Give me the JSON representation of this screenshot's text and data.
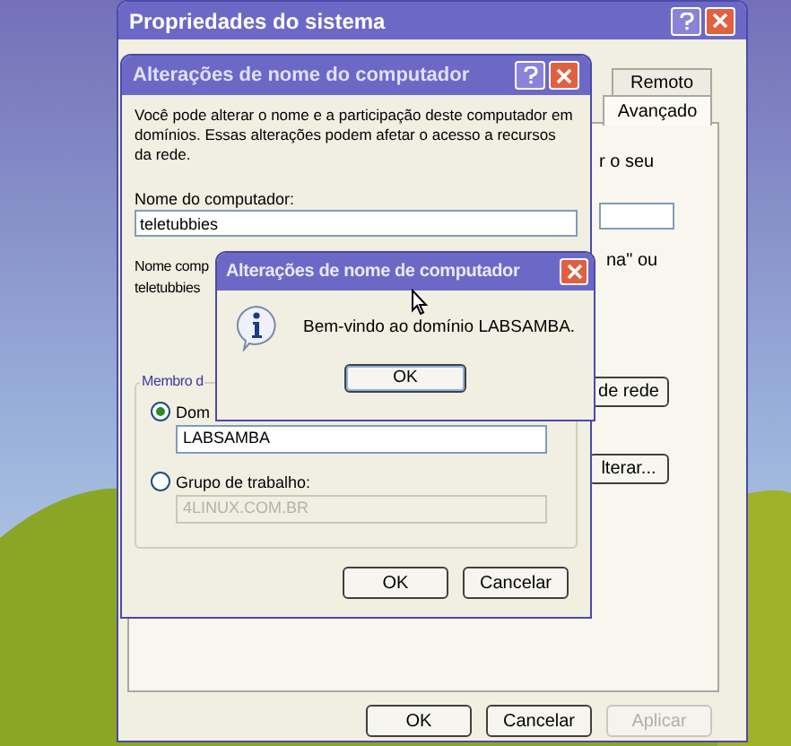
{
  "system_properties_window": {
    "title": "Propriedades do sistema",
    "tabs": [
      {
        "label": "Remoto",
        "selected": false
      },
      {
        "label": "Avançado",
        "selected": true
      }
    ],
    "partial_texts": [
      "r o seu",
      "na\" ou"
    ],
    "side_buttons": [
      "de rede",
      "lterar..."
    ],
    "buttons": [
      {
        "label": "OK",
        "disabled": false
      },
      {
        "label": "Cancelar",
        "disabled": false
      },
      {
        "label": "Aplicar",
        "disabled": true
      }
    ]
  },
  "name_change_dialog": {
    "title": "Alterações de nome do computador",
    "description": "Você pode alterar o nome e a participação deste computador em domínios. Essas alterações podem afetar o acesso a recursos da rede.",
    "computer_name_label": "Nome do computador:",
    "computer_name_value": "teletubbies",
    "full_name_label": "Nome comp",
    "full_name_value": "teletubbies",
    "member_label": "Membro d",
    "options": [
      {
        "label": "Dom",
        "selected": true,
        "value": "LABSAMBA",
        "disabled": false
      },
      {
        "label": "Grupo de trabalho:",
        "selected": false,
        "value": "4LINUX.COM.BR",
        "disabled": true
      }
    ],
    "buttons": [
      "OK",
      "Cancelar"
    ]
  },
  "message_box": {
    "title": "Alterações de nome de computador",
    "message": "Bem-vindo ao domínio LABSAMBA.",
    "button": "OK"
  }
}
